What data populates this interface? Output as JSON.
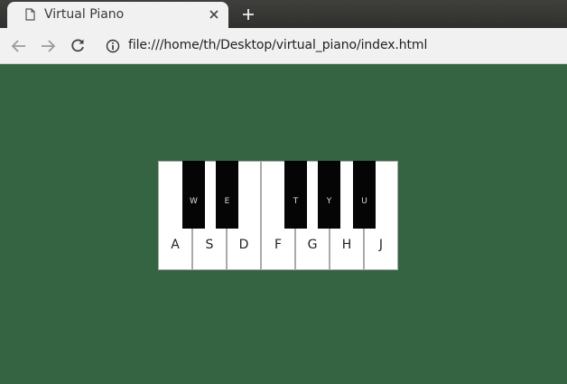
{
  "tab": {
    "title": "Virtual Piano"
  },
  "toolbar": {
    "url": "file:///home/th/Desktop/virtual_piano/index.html"
  },
  "icons": {
    "page": "page-icon",
    "close": "close-icon",
    "new_tab": "plus-icon",
    "back": "back-arrow-icon",
    "forward": "forward-arrow-icon",
    "reload": "reload-icon",
    "info": "info-icon"
  },
  "colors": {
    "page_background": "#356443",
    "white_key": "#ffffff",
    "black_key": "#050505"
  },
  "piano": {
    "white_keys": [
      "A",
      "S",
      "D",
      "F",
      "G",
      "H",
      "J"
    ],
    "black_keys": [
      "W",
      "E",
      "T",
      "Y",
      "U"
    ]
  }
}
